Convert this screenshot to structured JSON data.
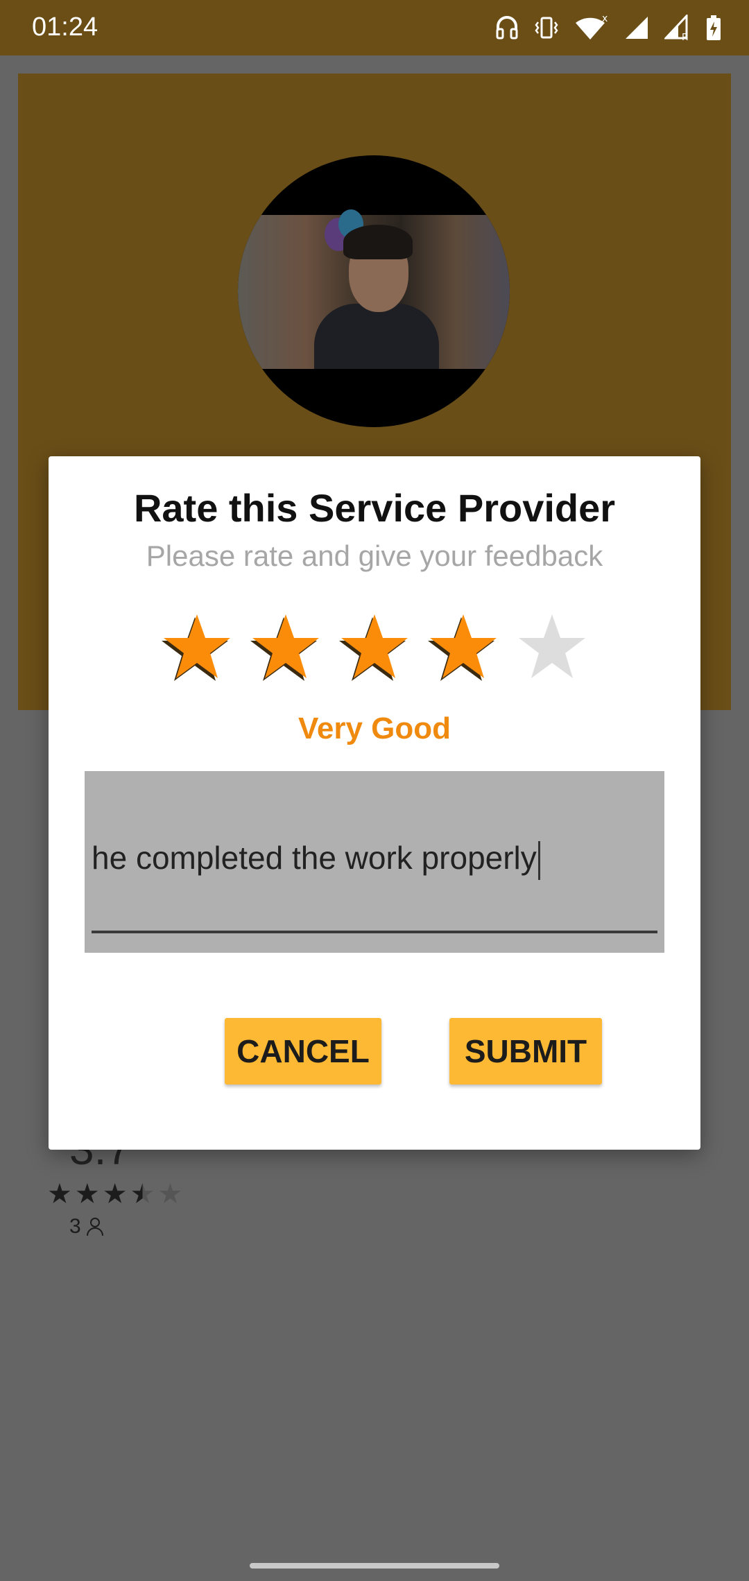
{
  "status_bar": {
    "time": "01:24",
    "icons": [
      "headphones-icon",
      "vibrate-icon",
      "wifi-icon",
      "signal-icon",
      "signal-roaming-icon",
      "battery-charging-icon"
    ]
  },
  "background": {
    "rating_value": "3.7",
    "rating_stars": 3.5,
    "reviewer_count": "3"
  },
  "dialog": {
    "title": "Rate this Service Provider",
    "subtitle": "Please rate and give your feedback",
    "rating": 4,
    "max_rating": 5,
    "rating_label": "Very Good",
    "feedback_value": "he completed the work properly",
    "cancel_label": "CANCEL",
    "submit_label": "SUBMIT"
  },
  "colors": {
    "star_active": "#fb8c0a",
    "star_inactive": "#dddddd",
    "rating_label": "#f08a0e",
    "button": "#fdb933",
    "status_bar": "#6a4e15"
  }
}
